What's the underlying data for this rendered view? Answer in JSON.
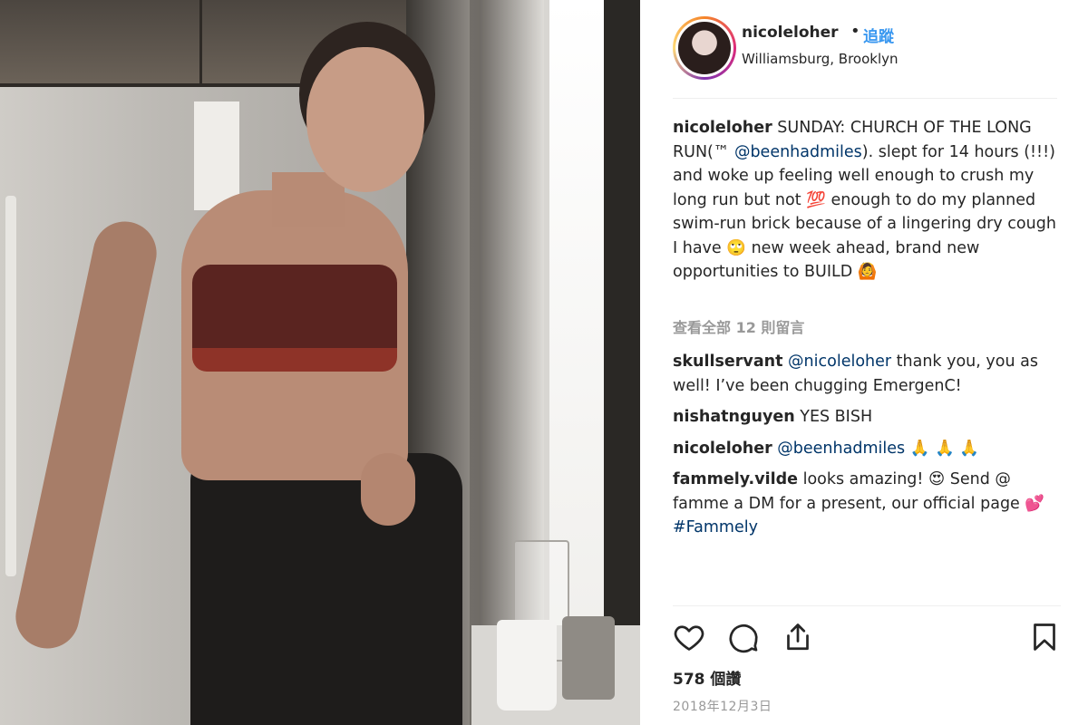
{
  "post": {
    "username": "nicoleloher",
    "dot": "•",
    "follow_label": "追蹤",
    "location": "Williamsburg, Brooklyn"
  },
  "caption": {
    "username": "nicoleloher",
    "part1": "SUNDAY: CHURCH OF THE LONG RUN(™ ",
    "mention": "@beenhadmiles",
    "part2": "). slept for 14 hours (!!!) and woke up feeling well enough to crush my long run but not 💯  enough to do my planned swim-run brick because of a lingering dry cough I have 🙄  new week ahead, brand new opportunities to BUILD 🙆"
  },
  "view_all_comments": "查看全部 12 則留言",
  "comments": [
    {
      "username": "skullservant",
      "mention": "@nicoleloher",
      "text": " thank you, you as well! I’ve been chugging EmergenC!"
    },
    {
      "username": "nishatnguyen",
      "mention": "",
      "text": " YES BISH"
    },
    {
      "username": "nicoleloher",
      "mention": "@beenhadmiles",
      "text": " 🙏 🙏 🙏"
    },
    {
      "username": "fammely.vilde",
      "mention": "",
      "text": " looks amazing! 😍  Send @ famme a DM for a present, our official page 💕  ",
      "hashtag": "#Fammely"
    }
  ],
  "actions": {
    "like_icon": "heart-icon",
    "comment_icon": "comment-icon",
    "share_icon": "share-icon",
    "save_icon": "bookmark-icon"
  },
  "likes": "578 個讚",
  "date": "2018年12月3日",
  "colors": {
    "link": "#3897f0",
    "mention": "#003569",
    "muted": "#999999",
    "text": "#262626"
  }
}
